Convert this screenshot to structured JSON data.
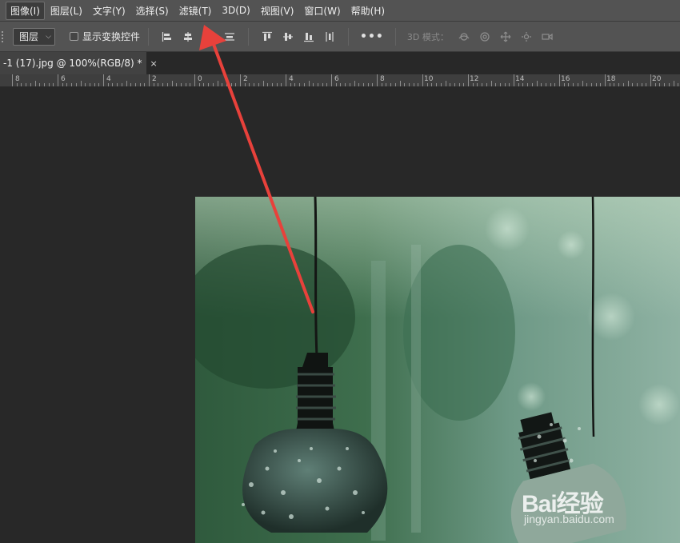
{
  "menu": {
    "items": [
      {
        "label": "图像(I)"
      },
      {
        "label": "图层(L)"
      },
      {
        "label": "文字(Y)"
      },
      {
        "label": "选择(S)"
      },
      {
        "label": "滤镜(T)"
      },
      {
        "label": "3D(D)"
      },
      {
        "label": "视图(V)"
      },
      {
        "label": "窗口(W)"
      },
      {
        "label": "帮助(H)"
      }
    ]
  },
  "options": {
    "auto_select_target": "图层",
    "show_transform_controls": "显示变换控件",
    "show_transform_checked": false,
    "more_label": "•••",
    "mode_3d_label": "3D 模式："
  },
  "document": {
    "tab_label": "-1 (17).jpg @ 100%(RGB/8) *",
    "close_label": "×"
  },
  "ruler": {
    "labels": [
      "8",
      "6",
      "4",
      "2",
      "0",
      "2",
      "4",
      "6",
      "8",
      "10",
      "12",
      "14",
      "16",
      "18",
      "20"
    ]
  },
  "watermark": {
    "brand": "Bai经验",
    "url": "jingyan.baidu.com"
  },
  "colors": {
    "annotation_arrow": "#e8413b",
    "menubar_bg": "#535353",
    "canvas_bg": "#282828"
  }
}
